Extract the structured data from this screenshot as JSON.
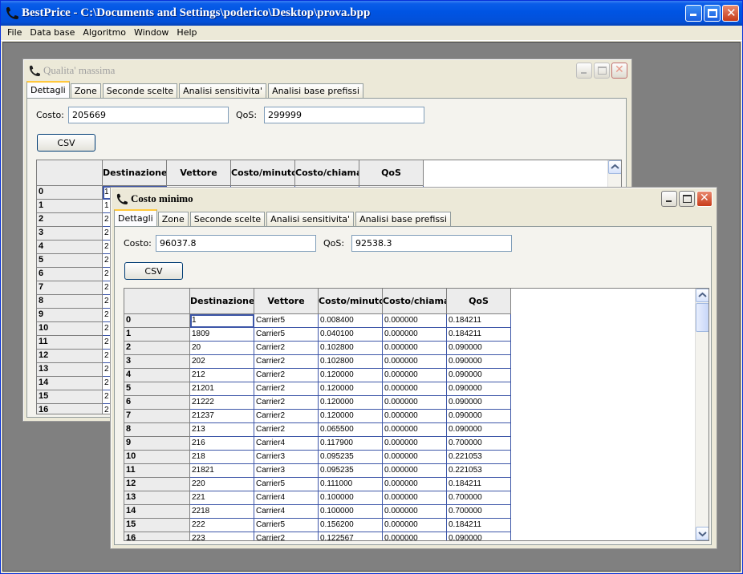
{
  "app": {
    "title": "BestPrice - C:\\Documents and Settings\\poderico\\Desktop\\prova.bpp",
    "menu": [
      "File",
      "Data base",
      "Algoritmo",
      "Window",
      "Help"
    ]
  },
  "columns": [
    "",
    "Destinazione",
    "Vettore",
    "Costo/minuto",
    "Costo/chiamat",
    "QoS"
  ],
  "qualita": {
    "title": "Qualita' massima",
    "tabs": [
      "Dettagli",
      "Zone",
      "Seconde scelte",
      "Analisi sensitivita'",
      "Analisi base prefissi"
    ],
    "costo_label": "Costo:",
    "costo_value": "205669",
    "qos_label": "QoS:",
    "qos_value": "299999",
    "csv_label": "CSV",
    "row_headers": [
      "0",
      "1",
      "2",
      "3",
      "4",
      "5",
      "6",
      "7",
      "8",
      "9",
      "10",
      "11",
      "12",
      "13",
      "14",
      "15",
      "16"
    ],
    "first_col": [
      "1",
      "1",
      "2",
      "2",
      "2",
      "2",
      "2",
      "2",
      "2",
      "2",
      "2",
      "2",
      "2",
      "2",
      "2",
      "2",
      "2"
    ]
  },
  "minimo": {
    "title": "Costo minimo",
    "tabs": [
      "Dettagli",
      "Zone",
      "Seconde scelte",
      "Analisi sensitivita'",
      "Analisi base prefissi"
    ],
    "costo_label": "Costo:",
    "costo_value": "96037.8",
    "qos_label": "QoS:",
    "qos_value": "92538.3",
    "csv_label": "CSV",
    "rows": [
      [
        "0",
        "1",
        "Carrier5",
        "0.008400",
        "0.000000",
        "0.184211"
      ],
      [
        "1",
        "1809",
        "Carrier5",
        "0.040100",
        "0.000000",
        "0.184211"
      ],
      [
        "2",
        "20",
        "Carrier2",
        "0.102800",
        "0.000000",
        "0.090000"
      ],
      [
        "3",
        "202",
        "Carrier2",
        "0.102800",
        "0.000000",
        "0.090000"
      ],
      [
        "4",
        "212",
        "Carrier2",
        "0.120000",
        "0.000000",
        "0.090000"
      ],
      [
        "5",
        "21201",
        "Carrier2",
        "0.120000",
        "0.000000",
        "0.090000"
      ],
      [
        "6",
        "21222",
        "Carrier2",
        "0.120000",
        "0.000000",
        "0.090000"
      ],
      [
        "7",
        "21237",
        "Carrier2",
        "0.120000",
        "0.000000",
        "0.090000"
      ],
      [
        "8",
        "213",
        "Carrier2",
        "0.065500",
        "0.000000",
        "0.090000"
      ],
      [
        "9",
        "216",
        "Carrier4",
        "0.117900",
        "0.000000",
        "0.700000"
      ],
      [
        "10",
        "218",
        "Carrier3",
        "0.095235",
        "0.000000",
        "0.221053"
      ],
      [
        "11",
        "21821",
        "Carrier3",
        "0.095235",
        "0.000000",
        "0.221053"
      ],
      [
        "12",
        "220",
        "Carrier5",
        "0.111000",
        "0.000000",
        "0.184211"
      ],
      [
        "13",
        "221",
        "Carrier4",
        "0.100000",
        "0.000000",
        "0.700000"
      ],
      [
        "14",
        "2218",
        "Carrier4",
        "0.100000",
        "0.000000",
        "0.700000"
      ],
      [
        "15",
        "222",
        "Carrier5",
        "0.156200",
        "0.000000",
        "0.184211"
      ],
      [
        "16",
        "223",
        "Carrier2",
        "0.122567",
        "0.000000",
        "0.090000"
      ]
    ]
  }
}
